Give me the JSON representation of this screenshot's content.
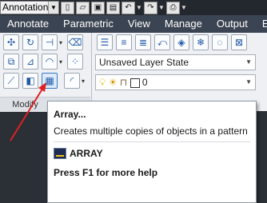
{
  "quick_access": {
    "workspace": "Annotation"
  },
  "tabs": [
    "Annotate",
    "Parametric",
    "View",
    "Manage",
    "Output",
    "Ex"
  ],
  "modify_panel": {
    "title": "Modify"
  },
  "layers_panel": {
    "layer_state": "Unsaved Layer State",
    "current_layer": "0"
  },
  "tooltip": {
    "title": "Array...",
    "description": "Creates multiple copies of objects in a pattern",
    "command": "ARRAY",
    "help": "Press F1 for more help"
  },
  "colors": {
    "ribbon_tab_bar": "#3b4452",
    "ribbon_body": "#eef0f3",
    "highlight_border": "#3a78c8",
    "annotation_arrow": "#e02020"
  }
}
